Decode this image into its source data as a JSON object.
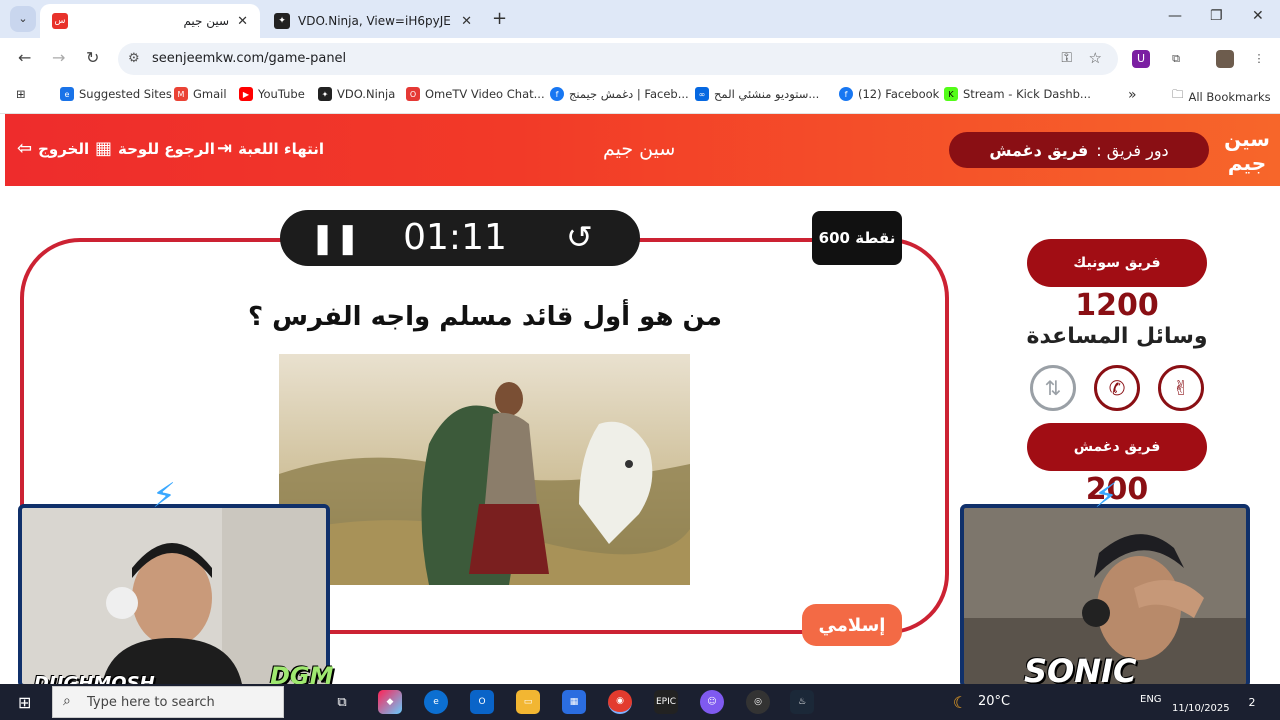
{
  "browser": {
    "tabs": [
      {
        "title": "سين جيم",
        "active": true
      },
      {
        "title": "VDO.Ninja, View=iH6pyJE",
        "active": false
      }
    ],
    "url": "seenjeemkw.com/game-panel",
    "bookmarks": [
      {
        "label": "Suggested Sites",
        "icon": "ie-icon"
      },
      {
        "label": "Gmail",
        "icon": "gmail-icon"
      },
      {
        "label": "YouTube",
        "icon": "youtube-icon"
      },
      {
        "label": "VDO.Ninja",
        "icon": "ninja-icon"
      },
      {
        "label": "OmeTV Video Chat...",
        "icon": "ometv-icon"
      },
      {
        "label": "دغمش جيمنج | Faceb...",
        "icon": "facebook-icon"
      },
      {
        "label": "ستوديو منشئي المح...",
        "icon": "meta-icon"
      },
      {
        "label": "(12) Facebook",
        "icon": "facebook-icon"
      },
      {
        "label": "Stream - Kick Dashb...",
        "icon": "kick-icon"
      }
    ],
    "all_bookmarks": "All Bookmarks",
    "overflow_label": "»"
  },
  "game": {
    "header": {
      "exit": "الخروج",
      "back_to_board": "الرجوع للوحة",
      "end_game": "انتهاء اللعبة",
      "site_title": "سين جيم",
      "turn_prefix": "دور فريق :",
      "turn_team": "فريق دغمش",
      "logo_text": "سين جيم"
    },
    "timer": {
      "time": "01:11"
    },
    "points": "600 نقطة",
    "question": "من هو أول قائد مسلم واجه الفرس ؟",
    "category": "إسلامي",
    "teams": [
      {
        "name": "فريق سونيك",
        "score": "1200"
      },
      {
        "name": "فريق دغمش",
        "score": "200"
      }
    ],
    "aids_label": "وسائل المساعدة",
    "aids": [
      {
        "icon": "peace-hand-icon",
        "used": false
      },
      {
        "icon": "phone-icon",
        "used": false
      },
      {
        "icon": "swap-icon",
        "used": true
      }
    ]
  },
  "overlays": {
    "left_cam_name": "DUGHMOSH",
    "left_logo": "DGM",
    "right_cam_name": "SONIC"
  },
  "taskbar": {
    "search_placeholder": "Type here to search",
    "temperature": "20°C",
    "lang": "ENG",
    "date": "11/10/2025",
    "notifications": "2"
  }
}
